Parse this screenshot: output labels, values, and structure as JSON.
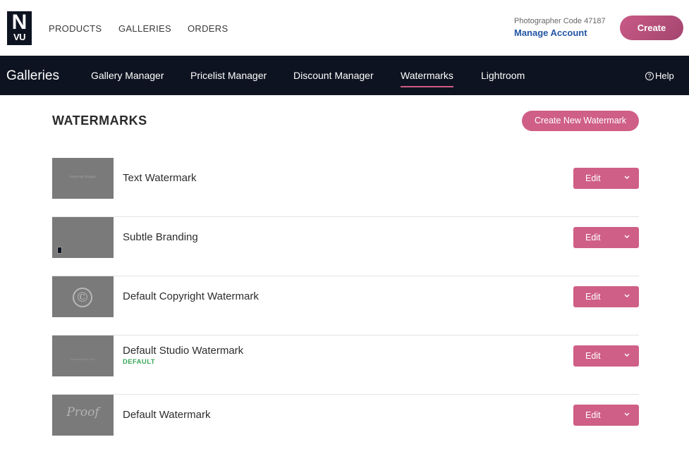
{
  "logo": {
    "line1": "N",
    "line2": "VU"
  },
  "top_nav": [
    "PRODUCTS",
    "GALLERIES",
    "ORDERS"
  ],
  "account": {
    "code": "Photographer Code 47187",
    "manage": "Manage Account"
  },
  "create_label": "Create",
  "sub_nav": {
    "brand": "Galleries",
    "items": [
      "Gallery Manager",
      "Pricelist Manager",
      "Discount Manager",
      "Watermarks",
      "Lightroom"
    ],
    "active": "Watermarks",
    "help": "Help",
    "help_glyph": "?"
  },
  "page": {
    "title": "WATERMARKS",
    "create_new": "Create New Watermark"
  },
  "watermarks": [
    {
      "name": "Text Watermark",
      "preview_text": "Amazing Images",
      "edit": "Edit",
      "icon": "text-watermark-thumbnail"
    },
    {
      "name": "Subtle Branding",
      "edit": "Edit",
      "icon": "branding-watermark-thumbnail"
    },
    {
      "name": "Default Copyright Watermark",
      "preview_text": "©",
      "edit": "Edit",
      "icon": "copyright-watermark-thumbnail"
    },
    {
      "name": "Default Studio Watermark",
      "badge": "DEFAULT",
      "preview_text": "Sonora Studio, LLC",
      "edit": "Edit",
      "icon": "studio-watermark-thumbnail"
    },
    {
      "name": "Default Watermark",
      "preview_text": "Proof",
      "edit": "Edit",
      "icon": "proof-watermark-thumbnail"
    }
  ],
  "colors": {
    "brand_dark": "#0d1320",
    "accent": "#cf5f86",
    "link": "#2255a4",
    "default_badge": "#3aa85a"
  }
}
